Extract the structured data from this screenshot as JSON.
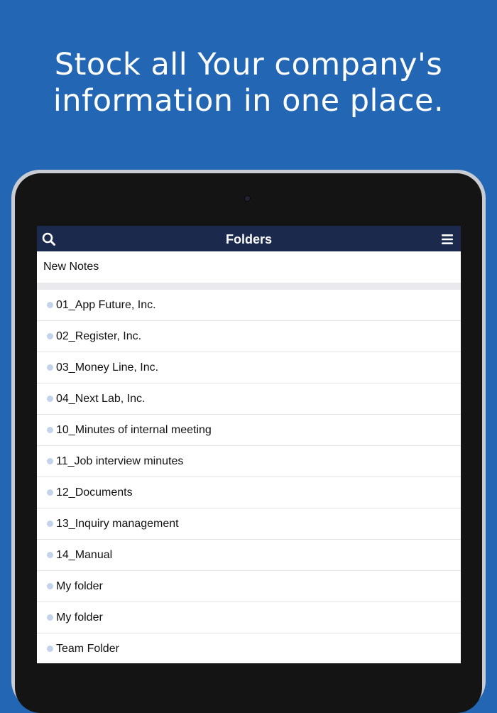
{
  "headline": {
    "line1": "Stock all Your company's",
    "line2": "information in one place."
  },
  "colors": {
    "background": "#2266B4",
    "navbar": "#1B2A4C",
    "bullet": "#C2D3EA"
  },
  "navbar": {
    "title": "Folders",
    "left_icon": "search-icon",
    "right_icon": "hamburger-menu-icon"
  },
  "new_notes": {
    "label": "New Notes"
  },
  "folders": [
    {
      "label": "01_App Future, Inc."
    },
    {
      "label": "02_Register, Inc."
    },
    {
      "label": "03_Money Line, Inc."
    },
    {
      "label": "04_Next Lab, Inc."
    },
    {
      "label": "10_Minutes of internal meeting"
    },
    {
      "label": "11_Job interview minutes"
    },
    {
      "label": "12_Documents"
    },
    {
      "label": "13_Inquiry management"
    },
    {
      "label": "14_Manual"
    },
    {
      "label": "My folder"
    },
    {
      "label": "My folder"
    },
    {
      "label": "Team Folder"
    }
  ]
}
